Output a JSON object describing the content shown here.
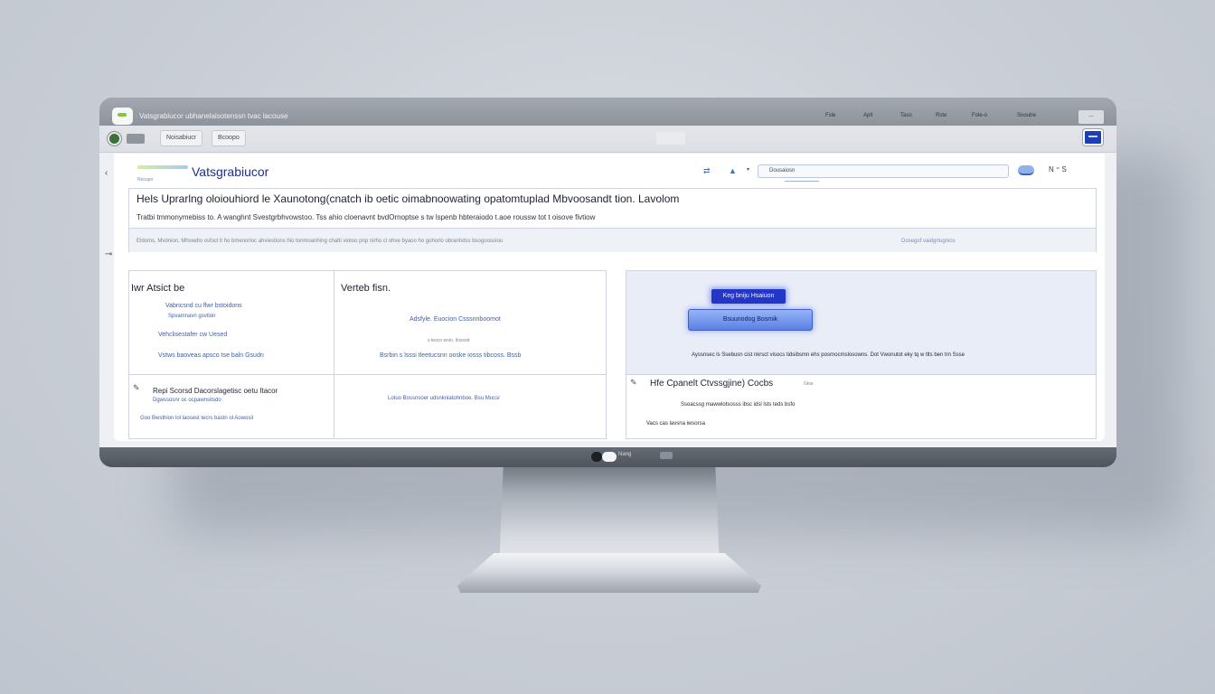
{
  "titlebar": {
    "title": "Vatsgrabiucor ubhanelaisotenssn tvac lacouse",
    "menu": [
      "Fsle",
      "Aplt",
      "Taso",
      "Rste",
      "Fole-o",
      "Snoutre"
    ],
    "window_button": "—"
  },
  "tabbar": {
    "tabs": [
      "Noisabiucr",
      "Bcoopo"
    ]
  },
  "header": {
    "brand": "Vatsgrabiucor",
    "brand_sub": "Nocupo",
    "search_placeholder": "Dousaiosn",
    "right_text": "N ⁼ S"
  },
  "banner": {
    "heading": "Hels Uprarlng oloiouhiord le Xaunotong(cnatch ib oetic oimabnoowating opatomtuplad Mbvoosandt tion. Lavolom",
    "subheading": "Tratbi tmmonymebiss to. A wanghnt Svestgrbhvowstoo. Tss ahio cloenavnt bvdOrnoptse s tw lspenb hbteraiodo t.aoe roussw tot t oisove fivtiow",
    "footer_left": "Eldoms, Mvdnion, Mhswdlo osfocl lt ho bmenorloc ahviestions hio tonmoanhing chatti viotoo pnp nirho cl ohve byaoo ho gohorlo obranhdss bsogoosuiou",
    "footer_right": "Dosegof vaidgrtugnios"
  },
  "left_panel": {
    "title_a": "Iwr Atsict be",
    "title_b": "Verteb fisn.",
    "items_a": [
      "Vabricsnd cu flwr bstoidons",
      "Spvamnavn gsvtion",
      "Vehclisestafer cw Uesed",
      "Vstws baoveas apsco tse baln Gsudn"
    ],
    "items_b": [
      "Adsfyle. Euocion Csssnnboomot",
      "s teocn wnio. Ilossod",
      "Bsrbin s lsssi tleetucsnn ooske iosss tibcoss. Bssb"
    ],
    "title_c": "Repi Scorsd Dacorslagetisc oetu Itacor",
    "items_c": [
      "Dgwssosnr oc ocpawnsitsdo",
      "Goo Bwsthion lol laosest tecrs bastn ol Aowosil"
    ],
    "center_c": "Lotuo Bossnsoer udsnkniatohnboe. Bsu Mucsr"
  },
  "right_panel": {
    "button_a": "Keg bniju Hsaiuon",
    "button_b": "Bsuunodog Bosmik",
    "caption": "Ayssnsec ls Ssebusn cist nkrsct visocs tidsibsmn ehs posrnocmslosowns. Dot Vwonutot eky tq w tlts ben trn Ssse",
    "title_c": "Hfe Cpanelt Ctvssgjine) Cocbs",
    "title_c_small": "Gtse",
    "items_c": [
      "Ssoacssg rnawwlotsosss ibsc idsl lsts teds bsfo",
      "Vacs cas lavsna iwsorsa"
    ]
  },
  "chin": {
    "label": "Nang"
  }
}
